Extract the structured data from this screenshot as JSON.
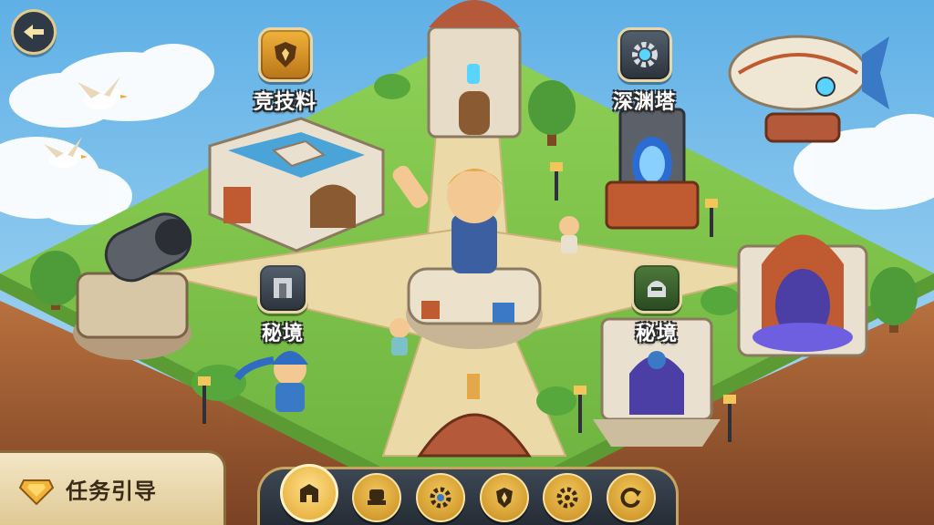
{
  "map": {
    "pois": [
      {
        "label": "竞技料",
        "icon": "shield-star-icon",
        "style": "gold"
      },
      {
        "label": "深渊塔",
        "icon": "gear-icon",
        "style": "dark"
      },
      {
        "label": "秘境",
        "icon": "stone-gate-icon",
        "style": "dark"
      },
      {
        "label": "秘境",
        "icon": "helmet-icon",
        "style": "green"
      }
    ]
  },
  "hud": {
    "back_button": {
      "icon": "back-arrow-icon"
    },
    "quest": {
      "label": "任务引导",
      "icon": "gold-gem-icon"
    },
    "bottom_nav": [
      {
        "icon": "gate-icon",
        "active": true
      },
      {
        "icon": "throne-icon",
        "active": false
      },
      {
        "icon": "gear-icon",
        "active": false
      },
      {
        "icon": "crest-icon",
        "active": false
      },
      {
        "icon": "cog-icon",
        "active": false
      },
      {
        "icon": "refresh-icon",
        "active": false
      }
    ]
  },
  "colors": {
    "sky": "#7fc3ec",
    "grass": "#7cc04a",
    "path": "#e8d4a2",
    "cliff": "#b06a3c",
    "accent": "#f2b33a"
  }
}
